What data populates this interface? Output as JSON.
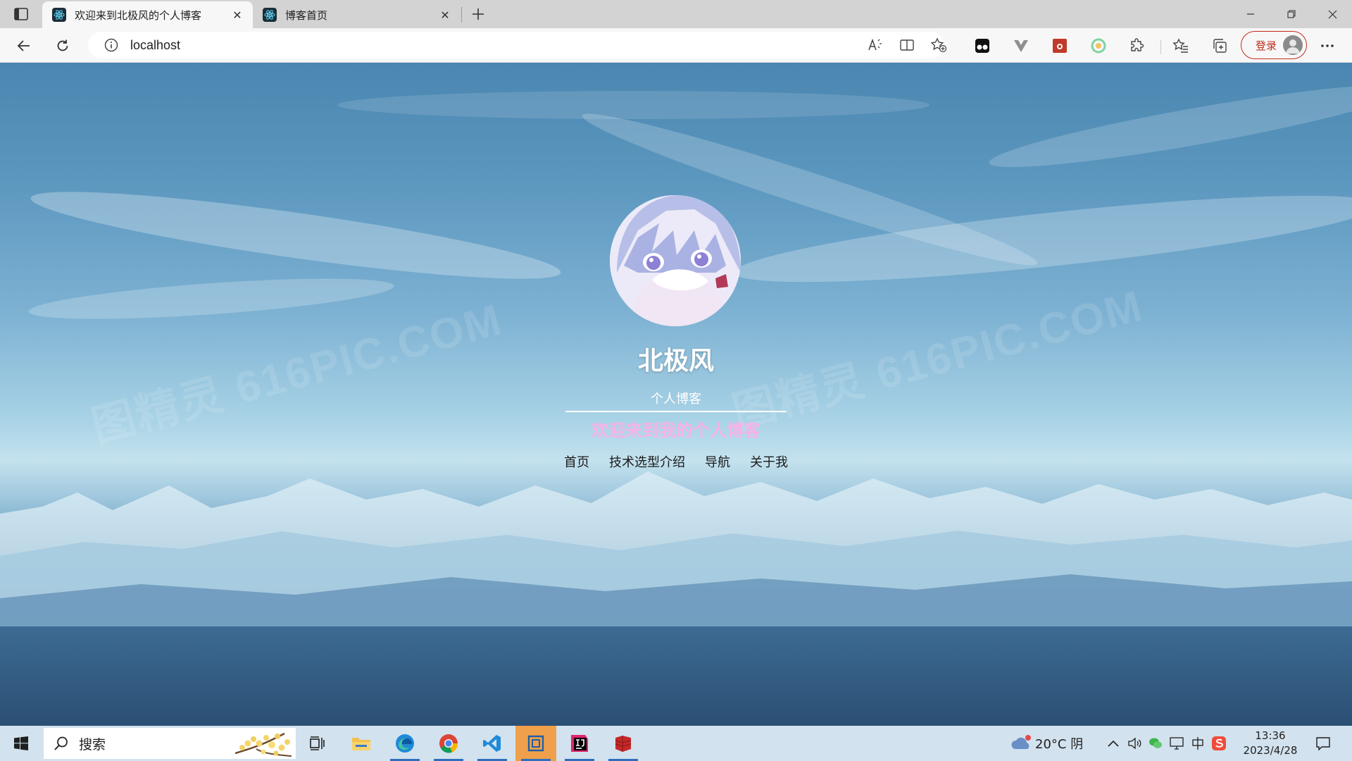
{
  "browser": {
    "tabs": [
      {
        "title": "欢迎来到北极风的个人博客",
        "active": true,
        "favicon": "react-icon"
      },
      {
        "title": "博客首页",
        "active": false,
        "favicon": "react-icon"
      }
    ],
    "address": "localhost",
    "signin_label": "登录"
  },
  "page": {
    "name": "北极风",
    "subtitle": "个人博客",
    "welcome": "欢迎来到我的个人博客",
    "nav": [
      "首页",
      "技术选型介绍",
      "导航",
      "关于我"
    ],
    "watermark": "图精灵 616PIC.COM",
    "colors": {
      "welcome": "#f6b3e6",
      "name": "#ffffff"
    }
  },
  "taskbar": {
    "search_label": "搜索",
    "weather": "20°C  阴",
    "time": "13:36",
    "date": "2023/4/28",
    "apps": [
      "task-view",
      "file-explorer",
      "edge",
      "chrome",
      "vscode",
      "virtualbox",
      "intellij",
      "redis"
    ]
  }
}
